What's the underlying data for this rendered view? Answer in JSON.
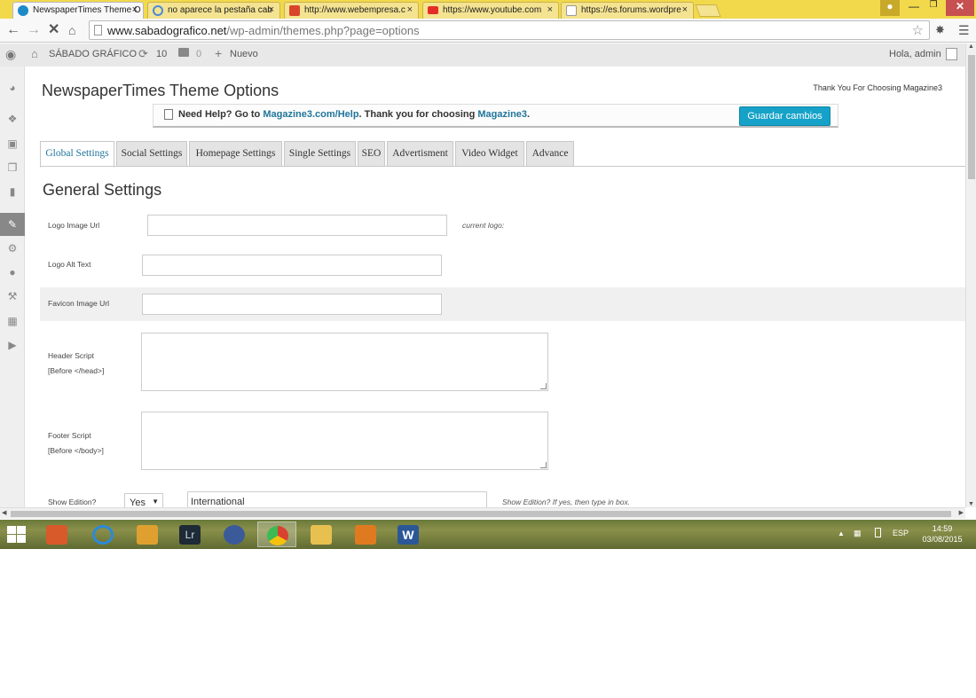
{
  "browser": {
    "tabs": [
      {
        "title": "NewspaperTimes Theme O",
        "favicon_color": "#1d8ac8",
        "active": true
      },
      {
        "title": "no aparece la pestaña cab",
        "favicon_color": "#4a8ad8",
        "active": false
      },
      {
        "title": "http://www.webempresa.c",
        "favicon_color": "#d8452a",
        "active": false
      },
      {
        "title": "https://www.youtube.com",
        "favicon_color": "#e52d27",
        "active": false
      },
      {
        "title": "https://es.forums.wordpre",
        "favicon_color": "#9a9a9a",
        "active": false
      }
    ],
    "close_glyph": "×",
    "url_host": "www.sabadografico.net",
    "url_path": "/wp-admin/themes.php?page=options"
  },
  "adminbar": {
    "site_name": "SÁBADO GRÁFICO",
    "updates_count": "10",
    "comments_count": "0",
    "new_label": "Nuevo",
    "greeting": "Hola, admin"
  },
  "page": {
    "theme_title": "NewspaperTimes Theme Options",
    "thanks_text": "Thank You For Choosing Magazine3",
    "help": {
      "prefix": "Need Help? Go to ",
      "link1": "Magazine3.com/Help",
      "middle": ". Thank you for choosing ",
      "link2": "Magazine3",
      "suffix": "."
    },
    "save_label": "Guardar cambios",
    "option_tabs": [
      "Global Settings",
      "Social Settings",
      "Homepage Settings",
      "Single Settings",
      "SEO",
      "Advertisment",
      "Video Widget",
      "Advance"
    ],
    "section_title": "General Settings",
    "fields": {
      "logo_url_label": "Logo Image Url",
      "logo_url_value": "",
      "logo_hint": "current logo:",
      "logo_alt_label": "Logo Alt Text",
      "logo_alt_value": "",
      "favicon_label": "Favicon Image Url",
      "favicon_value": "",
      "header_script_label1": "Header Script",
      "header_script_label2": "[Before </head>]",
      "footer_script_label1": "Footer Script",
      "footer_script_label2": "[Before </body>]",
      "show_edition_label": "Show Edition?",
      "show_edition_value": "Yes",
      "edition_text_value": "International",
      "show_edition_hint": "Show Edition? If yes, then type in box."
    }
  },
  "taskbar": {
    "language": "ESP",
    "time": "14:59",
    "date": "03/08/2015",
    "apps": [
      {
        "name": "control-panel-app",
        "color": "#d85a2a"
      },
      {
        "name": "internet-explorer-app",
        "color": "#2a8ad8"
      },
      {
        "name": "notes-app",
        "color": "#e0a030"
      },
      {
        "name": "lightroom-app",
        "color": "#1e2a36"
      },
      {
        "name": "shield-app",
        "color": "#3a5a9a"
      },
      {
        "name": "chrome-app",
        "color": "#d84030"
      },
      {
        "name": "file-explorer-app",
        "color": "#e8c050"
      },
      {
        "name": "outlook-app",
        "color": "#e07a20"
      },
      {
        "name": "word-app",
        "color": "#2b5797"
      }
    ],
    "lightroom_text": "Lr",
    "word_text": "W"
  },
  "colors": {
    "accent": "#16a2c8",
    "link": "#21759b"
  }
}
